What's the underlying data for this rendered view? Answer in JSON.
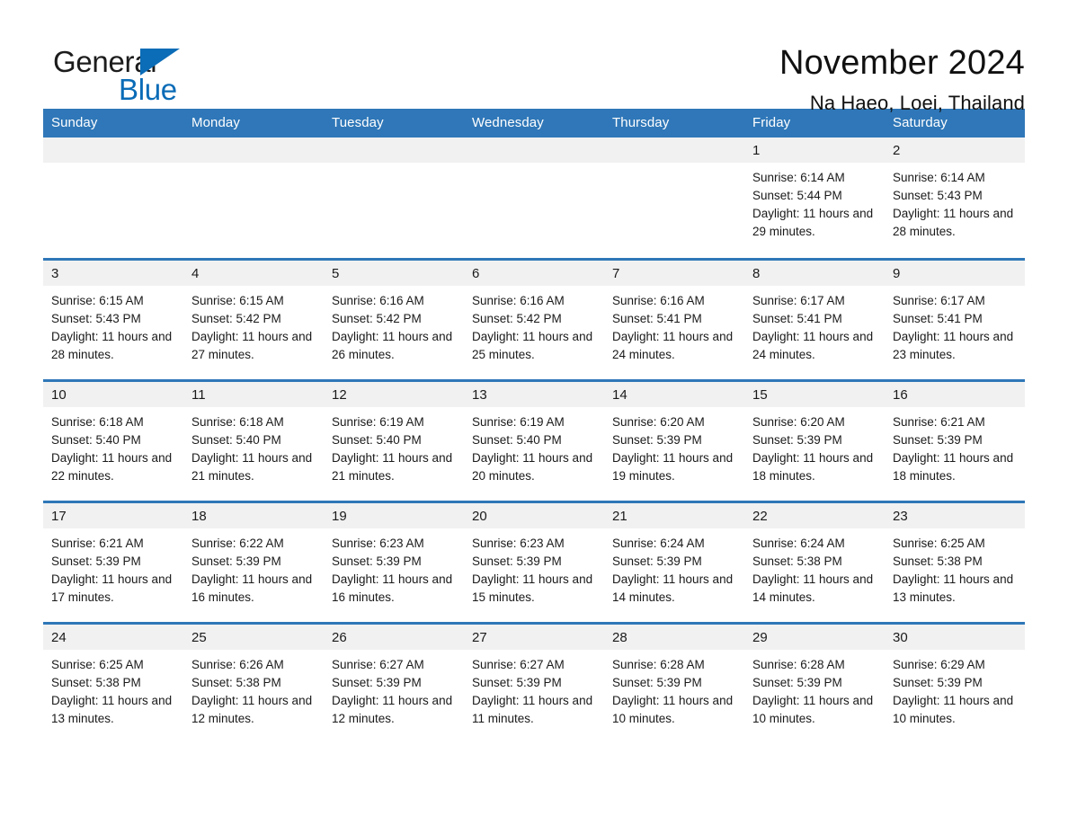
{
  "brand": {
    "word_one": "General",
    "word_two": "Blue",
    "accent_color": "#0b6cb7",
    "triangle_icon": "brand-triangle-icon"
  },
  "header": {
    "month_title": "November 2024",
    "location": "Na Haeo, Loei, Thailand"
  },
  "theme": {
    "header_blue": "#2f77b8",
    "daynum_gray": "#f1f1f1",
    "text": "#1a1a1a"
  },
  "weekdays": [
    "Sunday",
    "Monday",
    "Tuesday",
    "Wednesday",
    "Thursday",
    "Friday",
    "Saturday"
  ],
  "labels": {
    "sunrise_prefix": "Sunrise:",
    "sunset_prefix": "Sunset:",
    "daylight_prefix": "Daylight:"
  },
  "weeks": [
    [
      {
        "day": "",
        "sunrise": "",
        "sunset": "",
        "daylight": "",
        "empty": true
      },
      {
        "day": "",
        "sunrise": "",
        "sunset": "",
        "daylight": "",
        "empty": true
      },
      {
        "day": "",
        "sunrise": "",
        "sunset": "",
        "daylight": "",
        "empty": true
      },
      {
        "day": "",
        "sunrise": "",
        "sunset": "",
        "daylight": "",
        "empty": true
      },
      {
        "day": "",
        "sunrise": "",
        "sunset": "",
        "daylight": "",
        "empty": true
      },
      {
        "day": "1",
        "sunrise": "Sunrise: 6:14 AM",
        "sunset": "Sunset: 5:44 PM",
        "daylight": "Daylight: 11 hours and 29 minutes.",
        "empty": false
      },
      {
        "day": "2",
        "sunrise": "Sunrise: 6:14 AM",
        "sunset": "Sunset: 5:43 PM",
        "daylight": "Daylight: 11 hours and 28 minutes.",
        "empty": false
      }
    ],
    [
      {
        "day": "3",
        "sunrise": "Sunrise: 6:15 AM",
        "sunset": "Sunset: 5:43 PM",
        "daylight": "Daylight: 11 hours and 28 minutes.",
        "empty": false
      },
      {
        "day": "4",
        "sunrise": "Sunrise: 6:15 AM",
        "sunset": "Sunset: 5:42 PM",
        "daylight": "Daylight: 11 hours and 27 minutes.",
        "empty": false
      },
      {
        "day": "5",
        "sunrise": "Sunrise: 6:16 AM",
        "sunset": "Sunset: 5:42 PM",
        "daylight": "Daylight: 11 hours and 26 minutes.",
        "empty": false
      },
      {
        "day": "6",
        "sunrise": "Sunrise: 6:16 AM",
        "sunset": "Sunset: 5:42 PM",
        "daylight": "Daylight: 11 hours and 25 minutes.",
        "empty": false
      },
      {
        "day": "7",
        "sunrise": "Sunrise: 6:16 AM",
        "sunset": "Sunset: 5:41 PM",
        "daylight": "Daylight: 11 hours and 24 minutes.",
        "empty": false
      },
      {
        "day": "8",
        "sunrise": "Sunrise: 6:17 AM",
        "sunset": "Sunset: 5:41 PM",
        "daylight": "Daylight: 11 hours and 24 minutes.",
        "empty": false
      },
      {
        "day": "9",
        "sunrise": "Sunrise: 6:17 AM",
        "sunset": "Sunset: 5:41 PM",
        "daylight": "Daylight: 11 hours and 23 minutes.",
        "empty": false
      }
    ],
    [
      {
        "day": "10",
        "sunrise": "Sunrise: 6:18 AM",
        "sunset": "Sunset: 5:40 PM",
        "daylight": "Daylight: 11 hours and 22 minutes.",
        "empty": false
      },
      {
        "day": "11",
        "sunrise": "Sunrise: 6:18 AM",
        "sunset": "Sunset: 5:40 PM",
        "daylight": "Daylight: 11 hours and 21 minutes.",
        "empty": false
      },
      {
        "day": "12",
        "sunrise": "Sunrise: 6:19 AM",
        "sunset": "Sunset: 5:40 PM",
        "daylight": "Daylight: 11 hours and 21 minutes.",
        "empty": false
      },
      {
        "day": "13",
        "sunrise": "Sunrise: 6:19 AM",
        "sunset": "Sunset: 5:40 PM",
        "daylight": "Daylight: 11 hours and 20 minutes.",
        "empty": false
      },
      {
        "day": "14",
        "sunrise": "Sunrise: 6:20 AM",
        "sunset": "Sunset: 5:39 PM",
        "daylight": "Daylight: 11 hours and 19 minutes.",
        "empty": false
      },
      {
        "day": "15",
        "sunrise": "Sunrise: 6:20 AM",
        "sunset": "Sunset: 5:39 PM",
        "daylight": "Daylight: 11 hours and 18 minutes.",
        "empty": false
      },
      {
        "day": "16",
        "sunrise": "Sunrise: 6:21 AM",
        "sunset": "Sunset: 5:39 PM",
        "daylight": "Daylight: 11 hours and 18 minutes.",
        "empty": false
      }
    ],
    [
      {
        "day": "17",
        "sunrise": "Sunrise: 6:21 AM",
        "sunset": "Sunset: 5:39 PM",
        "daylight": "Daylight: 11 hours and 17 minutes.",
        "empty": false
      },
      {
        "day": "18",
        "sunrise": "Sunrise: 6:22 AM",
        "sunset": "Sunset: 5:39 PM",
        "daylight": "Daylight: 11 hours and 16 minutes.",
        "empty": false
      },
      {
        "day": "19",
        "sunrise": "Sunrise: 6:23 AM",
        "sunset": "Sunset: 5:39 PM",
        "daylight": "Daylight: 11 hours and 16 minutes.",
        "empty": false
      },
      {
        "day": "20",
        "sunrise": "Sunrise: 6:23 AM",
        "sunset": "Sunset: 5:39 PM",
        "daylight": "Daylight: 11 hours and 15 minutes.",
        "empty": false
      },
      {
        "day": "21",
        "sunrise": "Sunrise: 6:24 AM",
        "sunset": "Sunset: 5:39 PM",
        "daylight": "Daylight: 11 hours and 14 minutes.",
        "empty": false
      },
      {
        "day": "22",
        "sunrise": "Sunrise: 6:24 AM",
        "sunset": "Sunset: 5:38 PM",
        "daylight": "Daylight: 11 hours and 14 minutes.",
        "empty": false
      },
      {
        "day": "23",
        "sunrise": "Sunrise: 6:25 AM",
        "sunset": "Sunset: 5:38 PM",
        "daylight": "Daylight: 11 hours and 13 minutes.",
        "empty": false
      }
    ],
    [
      {
        "day": "24",
        "sunrise": "Sunrise: 6:25 AM",
        "sunset": "Sunset: 5:38 PM",
        "daylight": "Daylight: 11 hours and 13 minutes.",
        "empty": false
      },
      {
        "day": "25",
        "sunrise": "Sunrise: 6:26 AM",
        "sunset": "Sunset: 5:38 PM",
        "daylight": "Daylight: 11 hours and 12 minutes.",
        "empty": false
      },
      {
        "day": "26",
        "sunrise": "Sunrise: 6:27 AM",
        "sunset": "Sunset: 5:39 PM",
        "daylight": "Daylight: 11 hours and 12 minutes.",
        "empty": false
      },
      {
        "day": "27",
        "sunrise": "Sunrise: 6:27 AM",
        "sunset": "Sunset: 5:39 PM",
        "daylight": "Daylight: 11 hours and 11 minutes.",
        "empty": false
      },
      {
        "day": "28",
        "sunrise": "Sunrise: 6:28 AM",
        "sunset": "Sunset: 5:39 PM",
        "daylight": "Daylight: 11 hours and 10 minutes.",
        "empty": false
      },
      {
        "day": "29",
        "sunrise": "Sunrise: 6:28 AM",
        "sunset": "Sunset: 5:39 PM",
        "daylight": "Daylight: 11 hours and 10 minutes.",
        "empty": false
      },
      {
        "day": "30",
        "sunrise": "Sunrise: 6:29 AM",
        "sunset": "Sunset: 5:39 PM",
        "daylight": "Daylight: 11 hours and 10 minutes.",
        "empty": false
      }
    ]
  ]
}
